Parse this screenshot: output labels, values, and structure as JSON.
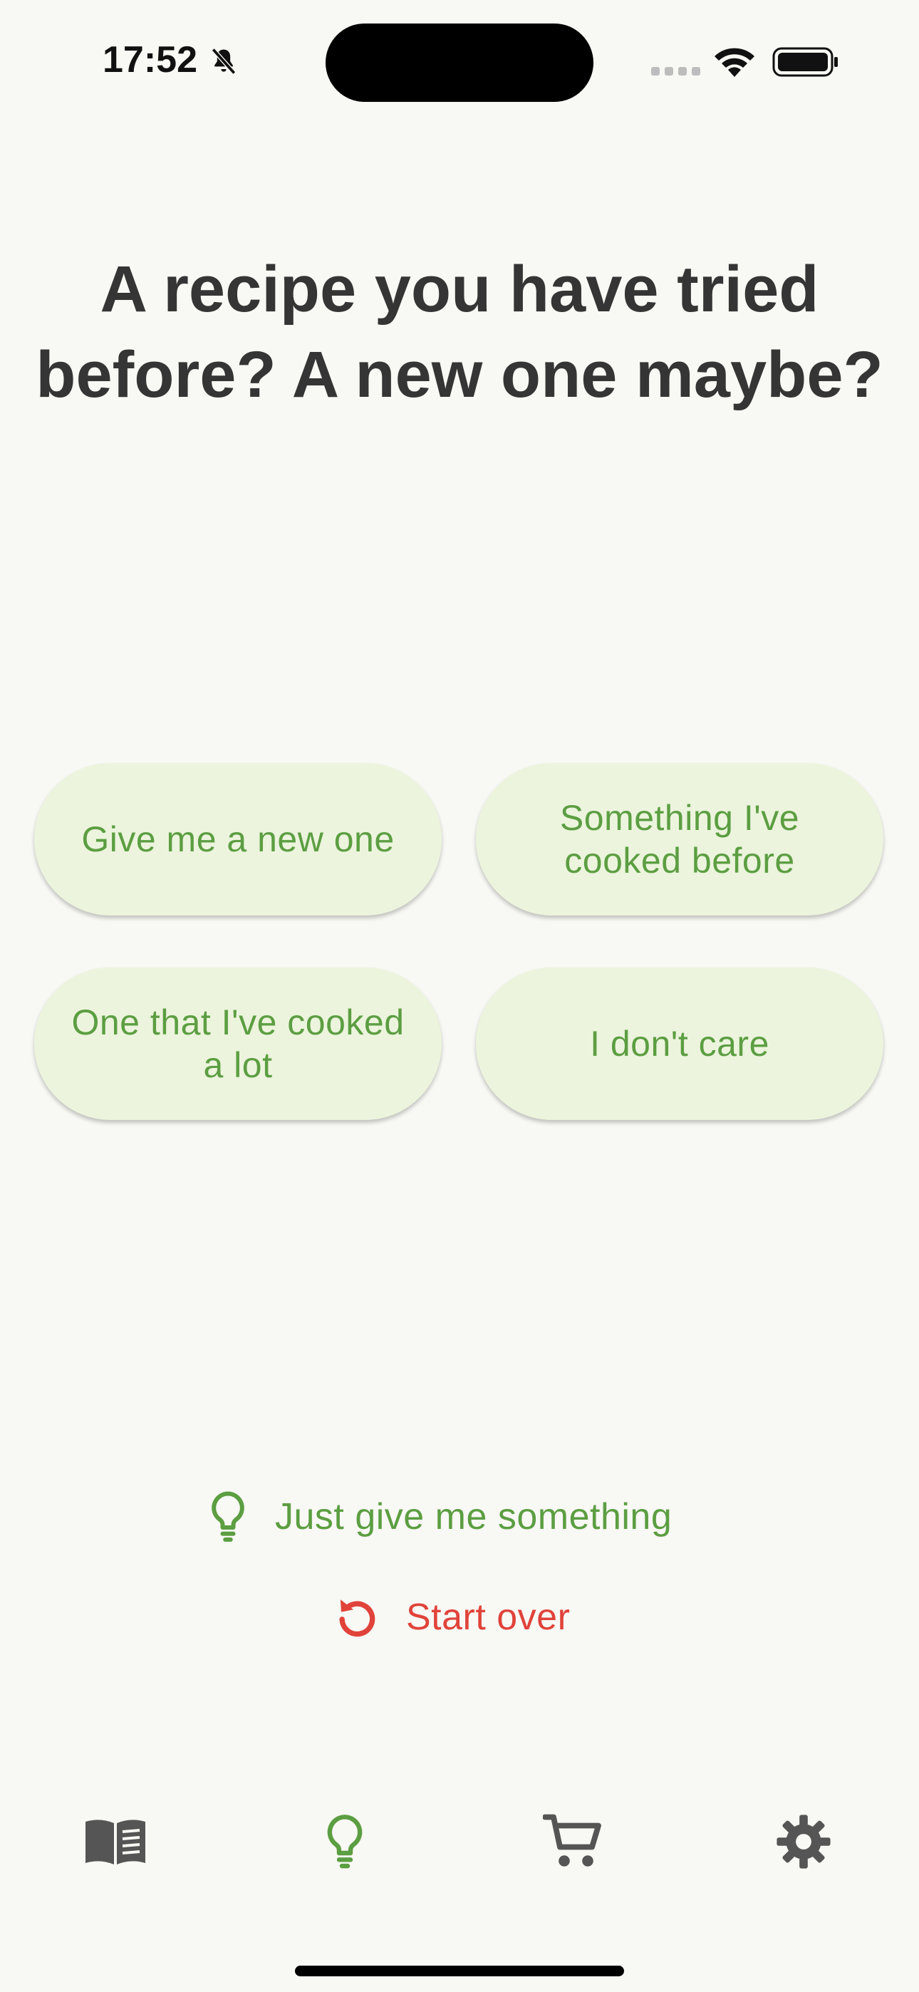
{
  "status_bar": {
    "time": "17:52",
    "icons": [
      "bell-slash-icon",
      "signal-icon",
      "wifi-icon",
      "battery-icon"
    ]
  },
  "question": {
    "title": "A recipe you have tried before? A new one maybe?"
  },
  "options": [
    {
      "label": "Give me a new one"
    },
    {
      "label": "Something I've cooked before"
    },
    {
      "label": "One that I've cooked a lot"
    },
    {
      "label": "I don't care"
    }
  ],
  "actions": {
    "suggest_label": "Just give me something",
    "restart_label": "Start over"
  },
  "bottom_nav": {
    "items": [
      {
        "icon": "book-icon",
        "active": false
      },
      {
        "icon": "lightbulb-icon",
        "active": true
      },
      {
        "icon": "cart-icon",
        "active": false
      },
      {
        "icon": "gear-icon",
        "active": false
      }
    ]
  },
  "colors": {
    "accent_green": "#5c9e42",
    "button_bg": "#ecf4dd",
    "danger_red": "#e0433a",
    "text_dark": "#353535",
    "icon_gray": "#555555",
    "background": "#f8f8f4"
  }
}
